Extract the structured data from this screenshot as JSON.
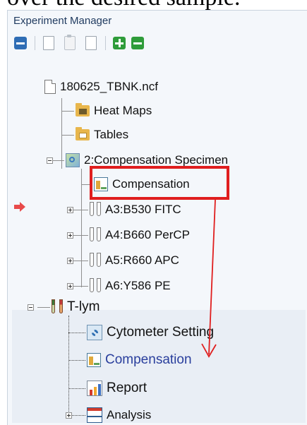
{
  "doc_caption": "over the desired sample.",
  "panel": {
    "title": "Experiment Manager"
  },
  "toolbar": {
    "buttons": [
      "collapse-all-icon",
      "copy-icon",
      "paste-icon",
      "duplicate-icon",
      "add-icon",
      "remove-icon"
    ]
  },
  "tree": {
    "experiment": "180625_TBNK.ncf",
    "heat_maps": "Heat Maps",
    "tables": "Tables",
    "specimen": "2:Compensation Specimen",
    "compensation_setup": "Compensation",
    "tubes": [
      "A3:B530 FITC",
      "A4:B660 PerCP",
      "A5:R660 APC",
      "A6:Y586 PE"
    ],
    "t_lym": "T-lym",
    "t_lym_children": {
      "cytometer_setting": "Cytometer Setting",
      "compensation": "Compensation",
      "report": "Report",
      "analysis": "Analysis"
    }
  },
  "colors": {
    "highlight": "#e01e1e",
    "link": "#2a3f9d",
    "pointer": "#e84a4a"
  }
}
